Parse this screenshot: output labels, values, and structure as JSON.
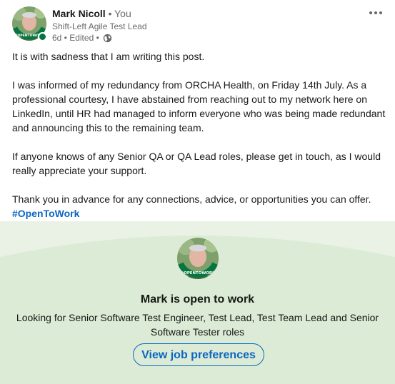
{
  "author": {
    "name": "Mark Nicoll",
    "relation": "• You",
    "headline": "Shift-Left Agile Test Lead",
    "meta": "6d • Edited •",
    "avatar_badge": "#OPENTOWORK",
    "avatar_icon": "open-to-work-frame-icon",
    "visibility_icon": "globe-icon"
  },
  "menu": {
    "icon": "more-options-icon"
  },
  "post": {
    "paragraph_1": "It is with sadness that I am writing this post.",
    "paragraph_2": "I was informed of my redundancy from ORCHA Health, on Friday 14th July. As a professional courtesy, I have abstained from reaching out to my network here on LinkedIn, until HR had managed to inform everyone who was being made redundant and announcing this to the remaining team.",
    "paragraph_3": "If anyone knows of any Senior QA or QA Lead roles, please get in touch, as I would really appreciate your support.",
    "paragraph_4": "Thank you in advance for any connections, advice, or opportunities you can offer.",
    "hashtag": "#OpenToWork"
  },
  "open_to_work": {
    "title": "Mark is open to work",
    "description": "Looking for Senior Software Test Engineer, Test Lead, Test Team Lead and Senior Software Tester roles",
    "button_label": "View job preferences"
  },
  "colors": {
    "accent": "#0a66c2",
    "open_to_work_green": "#057642",
    "banner_bg": "#dcebd6"
  }
}
